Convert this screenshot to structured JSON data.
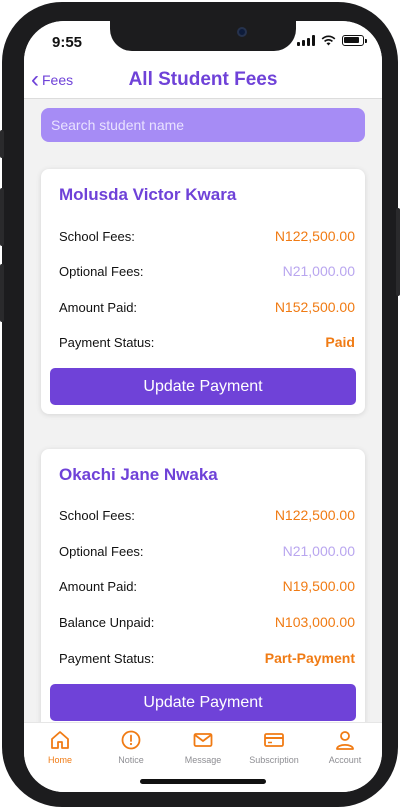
{
  "status_bar": {
    "time": "9:55"
  },
  "nav": {
    "back_label": "Fees",
    "title": "All Student Fees"
  },
  "search": {
    "placeholder": "Search student name"
  },
  "students": [
    {
      "name": "Molusda Victor Kwara",
      "rows": [
        {
          "label": "School Fees:",
          "value": "N122,500.00"
        },
        {
          "label": "Optional Fees:",
          "value": "N21,000.00"
        },
        {
          "label": "Amount Paid:",
          "value": "N152,500.00"
        },
        {
          "label": "Payment Status:",
          "value": "Paid"
        }
      ],
      "button": "Update Payment"
    },
    {
      "name": "Okachi Jane Nwaka",
      "rows": [
        {
          "label": "School Fees:",
          "value": "N122,500.00"
        },
        {
          "label": "Optional Fees:",
          "value": "N21,000.00"
        },
        {
          "label": "Amount Paid:",
          "value": "N19,500.00"
        },
        {
          "label": "Balance Unpaid:",
          "value": "N103,000.00"
        },
        {
          "label": "Payment Status:",
          "value": "Part-Payment"
        }
      ],
      "button": "Update Payment"
    }
  ],
  "tabs": [
    {
      "label": "Home",
      "icon": "home-icon",
      "active": true
    },
    {
      "label": "Notice",
      "icon": "alert-circle-icon",
      "active": false
    },
    {
      "label": "Message",
      "icon": "envelope-icon",
      "active": false
    },
    {
      "label": "Subscription",
      "icon": "credit-card-icon",
      "active": false
    },
    {
      "label": "Account",
      "icon": "user-icon",
      "active": false
    }
  ],
  "colors": {
    "accent": "#6f42d8",
    "search_bg": "#a68cf5",
    "amount": "#f07b14",
    "optional_amount": "#b9a6ef",
    "tab_active": "#f07b14",
    "tab_inactive": "#8e8e93"
  }
}
